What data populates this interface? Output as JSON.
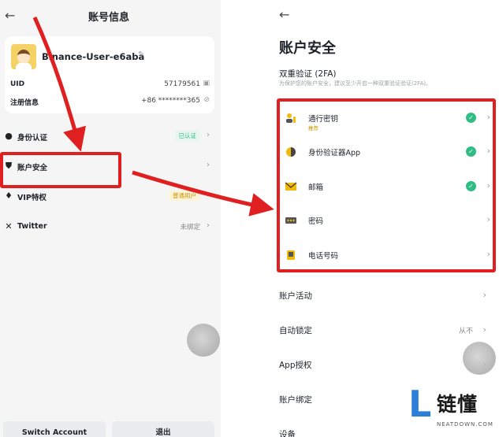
{
  "left_panel": {
    "title": "账号信息",
    "back_icon": "←",
    "profile": {
      "username": "Binance-User-e6aba",
      "uid_label": "UID",
      "uid_value": "57179561",
      "reg_label": "注册信息",
      "reg_value": "+86 ********365"
    },
    "menu": [
      {
        "label": "身份认证",
        "badge": "已认证",
        "icon": "person-icon"
      },
      {
        "label": "账户安全",
        "icon": "shield-icon"
      },
      {
        "label": "VIP特权",
        "badge": "普通用户",
        "icon": "vip-icon"
      },
      {
        "label": "Twitter",
        "status": "未绑定",
        "icon": "x-logo-icon"
      }
    ],
    "buttons": {
      "switch_account": "Switch Account",
      "logout": "退出"
    }
  },
  "right_panel": {
    "back_icon": "←",
    "title": "账户安全",
    "section_title": "双重验证 (2FA)",
    "section_subtitle": "为保护您的账户安全，建议至少开启一种双重验证验证(2FA)。",
    "tfa_items": [
      {
        "label": "通行密钥",
        "sub": "推荐",
        "enabled": true,
        "icon": "passkey-icon"
      },
      {
        "label": "身份验证器App",
        "enabled": true,
        "icon": "authenticator-icon"
      },
      {
        "label": "邮箱",
        "enabled": true,
        "icon": "email-icon"
      },
      {
        "label": "密码",
        "enabled": false,
        "icon": "password-icon"
      },
      {
        "label": "电话号码",
        "enabled": false,
        "icon": "phone-icon"
      }
    ],
    "settings": [
      {
        "label": "账户活动"
      },
      {
        "label": "自动锁定",
        "value": "从不"
      },
      {
        "label": "App授权"
      },
      {
        "label": "账户绑定"
      },
      {
        "label": "设备"
      }
    ]
  },
  "watermark": {
    "cn": "链懂",
    "en": "NEATDOWN.COM",
    "letter": "L"
  },
  "colors": {
    "highlight": "#e02020",
    "success": "#2ebd85",
    "brand": "#f0b90b",
    "watermark_blue": "#2c7fd6"
  }
}
